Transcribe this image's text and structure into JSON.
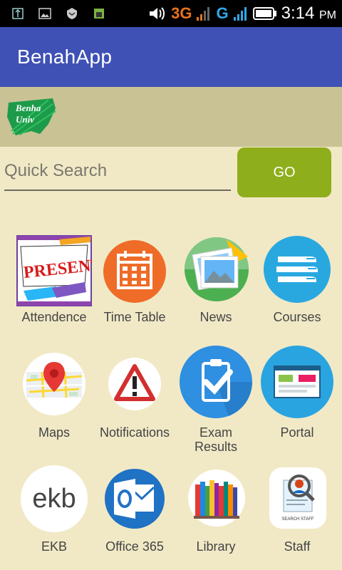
{
  "status_bar": {
    "network_3g": "3G",
    "network_g": "G",
    "time": "3:14",
    "ampm": "PM"
  },
  "app": {
    "title": "BenahApp"
  },
  "banner": {
    "logo_line1": "Benha",
    "logo_line2": "Univ"
  },
  "search": {
    "placeholder": "Quick Search",
    "value": "",
    "go_label": "GO"
  },
  "tiles": [
    {
      "label": "Attendence",
      "icon": "present-icon",
      "present_text": "PRESENT!"
    },
    {
      "label": "Time Table",
      "icon": "calendar-icon"
    },
    {
      "label": "News",
      "icon": "photos-icon"
    },
    {
      "label": "Courses",
      "icon": "books-icon"
    },
    {
      "label": "Maps",
      "icon": "map-pin-icon"
    },
    {
      "label": "Notifications",
      "icon": "warning-icon"
    },
    {
      "label": "Exam Results",
      "label_line1": "Exam",
      "label_line2": "Results",
      "icon": "clipboard-check-icon"
    },
    {
      "label": "Portal",
      "icon": "browser-window-icon"
    },
    {
      "label": "EKB",
      "icon": "ekb-logo",
      "logo_text": "ekb"
    },
    {
      "label": "Office 365",
      "icon": "outlook-icon"
    },
    {
      "label": "Library",
      "icon": "bookshelf-icon"
    },
    {
      "label": "Staff",
      "icon": "search-staff-icon",
      "caption": "SEARCH STAFF"
    }
  ],
  "colors": {
    "app_bar": "#3f51b5",
    "background": "#f1e9c6",
    "banner": "#c9c295",
    "go_button": "#8fae1b",
    "status_3g": "#e8731b",
    "status_g": "#35a7e8"
  }
}
